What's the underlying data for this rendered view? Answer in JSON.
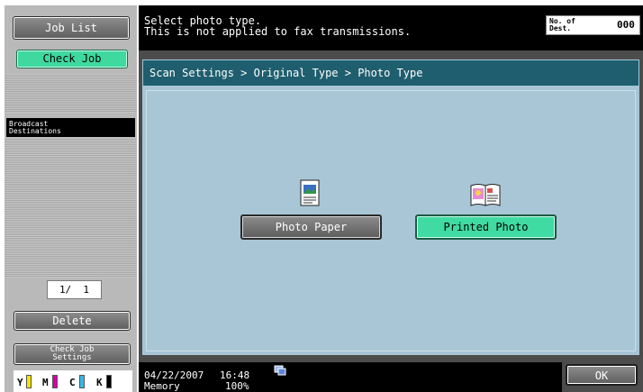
{
  "left_pane": {
    "job_list_label": "Job List",
    "check_job_label": "Check Job",
    "broadcast_line1": "Broadcast",
    "broadcast_line2": "Destinations",
    "page_indicator": "1/  1",
    "delete_label": "Delete",
    "check_job_settings_line1": "Check Job",
    "check_job_settings_line2": "Settings",
    "toner": [
      {
        "letter": "Y",
        "color": "#f2e400"
      },
      {
        "letter": "M",
        "color": "#d400a6"
      },
      {
        "letter": "C",
        "color": "#35b7e6"
      },
      {
        "letter": "K",
        "color": "#000000"
      }
    ]
  },
  "message": {
    "line1": "Select photo type.",
    "line2": "This is not applied to fax transmissions."
  },
  "dest_counter": {
    "label_line1": "No. of",
    "label_line2": "Dest.",
    "value": "000"
  },
  "breadcrumb": "Scan Settings > Original Type > Photo Type",
  "options": [
    {
      "label": "Photo Paper",
      "icon": "photo-paper-icon",
      "selected": false
    },
    {
      "label": "Printed Photo",
      "icon": "printed-photo-icon",
      "selected": true
    }
  ],
  "status": {
    "date": "04/22/2007",
    "time": "16:48",
    "memory_label": "Memory",
    "memory_value": "100%"
  },
  "ok_label": "OK",
  "colors": {
    "selected_green": "#40dba2",
    "breadcrumb_bg": "#1f5e6e",
    "content_bg": "#a8c5d6"
  }
}
